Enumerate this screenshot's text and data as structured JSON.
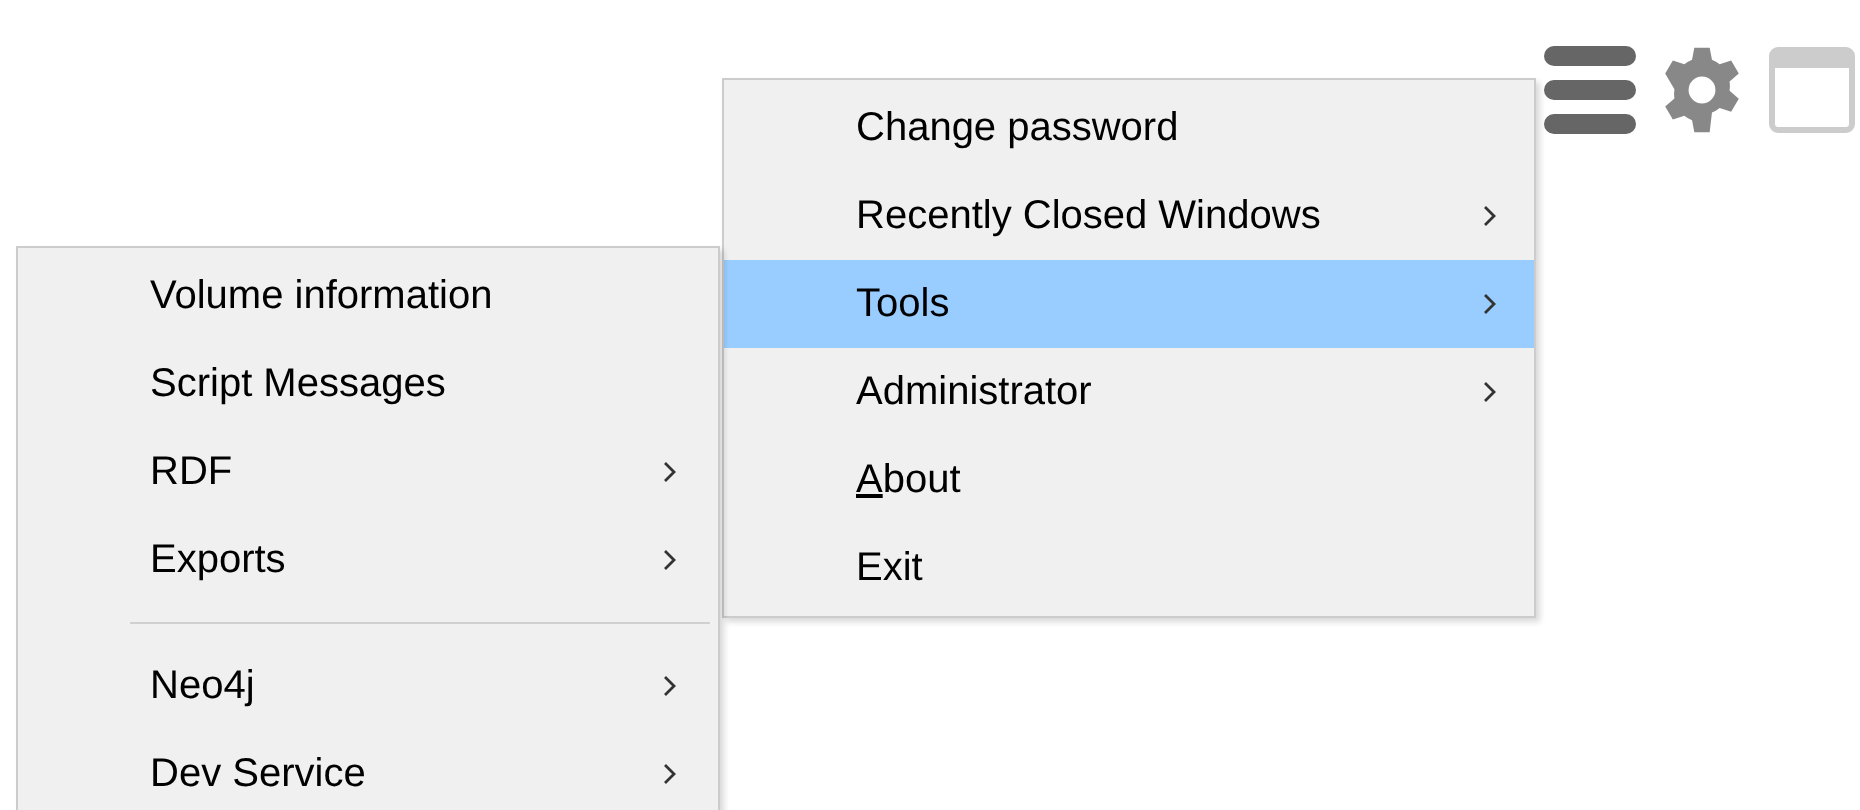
{
  "main_menu": {
    "items": [
      {
        "kind": "item",
        "label": "Change password",
        "submenu": false,
        "selected": false,
        "underline_first": false
      },
      {
        "kind": "item",
        "label": "Recently Closed Windows",
        "submenu": true,
        "selected": false,
        "underline_first": false
      },
      {
        "kind": "item",
        "label": "Tools",
        "submenu": true,
        "selected": true,
        "underline_first": false
      },
      {
        "kind": "item",
        "label": "Administrator",
        "submenu": true,
        "selected": false,
        "underline_first": false
      },
      {
        "kind": "item",
        "label": "About",
        "submenu": false,
        "selected": false,
        "underline_first": true
      },
      {
        "kind": "item",
        "label": "Exit",
        "submenu": false,
        "selected": false,
        "underline_first": false
      }
    ]
  },
  "tools_submenu": {
    "items": [
      {
        "kind": "item",
        "label": "Volume information",
        "submenu": false,
        "selected": false,
        "underline_first": false
      },
      {
        "kind": "item",
        "label": "Script Messages",
        "submenu": false,
        "selected": false,
        "underline_first": false
      },
      {
        "kind": "item",
        "label": "RDF",
        "submenu": true,
        "selected": false,
        "underline_first": false
      },
      {
        "kind": "item",
        "label": "Exports",
        "submenu": true,
        "selected": false,
        "underline_first": false
      },
      {
        "kind": "separator"
      },
      {
        "kind": "item",
        "label": "Neo4j",
        "submenu": true,
        "selected": false,
        "underline_first": false
      },
      {
        "kind": "item",
        "label": "Dev Service",
        "submenu": true,
        "selected": false,
        "underline_first": false
      }
    ]
  }
}
